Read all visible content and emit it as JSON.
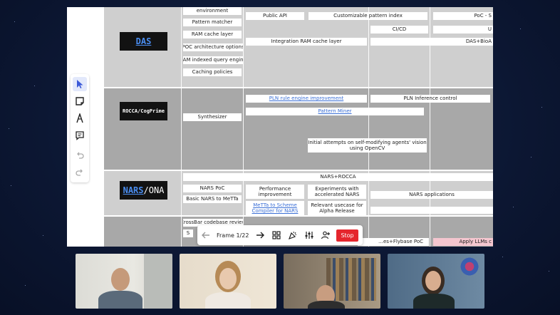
{
  "board": {
    "rows": [
      {
        "name": "DAS",
        "cards": [
          {
            "text": "environment"
          },
          {
            "text": "Pattern matcher"
          },
          {
            "text": "RAM cache layer"
          },
          {
            "text": "POC architecture options"
          },
          {
            "text": "RAM indexed query engine"
          },
          {
            "text": "Caching policies"
          },
          {
            "text": "Public API"
          },
          {
            "text": "Customizable pattern index"
          },
          {
            "text": "PoC - S"
          },
          {
            "text": "CI/CD"
          },
          {
            "text": "U"
          },
          {
            "text": "Integration RAM cache layer"
          },
          {
            "text": "DAS+BioA"
          }
        ]
      },
      {
        "name": "ROCCA/CogPrime",
        "cards": [
          {
            "text": "Synthesizer"
          },
          {
            "text": "PLN rule engine improvement"
          },
          {
            "text": "PLN Inference control"
          },
          {
            "text": "Pattern Miner"
          },
          {
            "text": "Initial attempts on self-modifying agents' vision using  OpenCV"
          }
        ]
      },
      {
        "name_part1": "NARS",
        "name_part2": "/ONA",
        "cards": [
          {
            "text": "NARS+ROCCA"
          },
          {
            "text": "NARS PoC"
          },
          {
            "text": "Performance improvement"
          },
          {
            "text": "Experiments with accelerated NARS"
          },
          {
            "text": "Basic NARS to MeTTa"
          },
          {
            "text": "NARS applications"
          },
          {
            "text": "MeTTa to Scheme Compiler for NARS"
          },
          {
            "text": "Relevant usecase for Alpha Release"
          }
        ]
      },
      {
        "cards": [
          {
            "text": "CrossBar codebase review"
          },
          {
            "text": "S"
          },
          {
            "text": "…es+Flybase PoC"
          },
          {
            "text": "Apply LLMs c"
          }
        ]
      }
    ]
  },
  "palette": {
    "tools": [
      {
        "icon": "cursor-icon",
        "active": true
      },
      {
        "icon": "sticky-note-icon",
        "active": false
      },
      {
        "icon": "pen-icon",
        "active": false
      },
      {
        "icon": "comment-icon",
        "active": false
      },
      {
        "icon": "undo-icon",
        "active": false
      },
      {
        "icon": "redo-icon",
        "active": false
      }
    ]
  },
  "framebar": {
    "frame_label": "Frame 1/22",
    "stop_label": "Stop",
    "icons": [
      "arrow-left-icon",
      "arrow-right-icon",
      "grid-icon",
      "celebrate-icon",
      "sliders-icon",
      "add-person-icon"
    ],
    "stop_color": "#e5262d"
  },
  "participants": [
    {
      "tile": "participant-1"
    },
    {
      "tile": "participant-2"
    },
    {
      "tile": "participant-3"
    },
    {
      "tile": "participant-4"
    }
  ],
  "colors": {
    "background": "#0c1733",
    "link": "#3a6fd6",
    "logo_accent": "#4a8df0"
  }
}
